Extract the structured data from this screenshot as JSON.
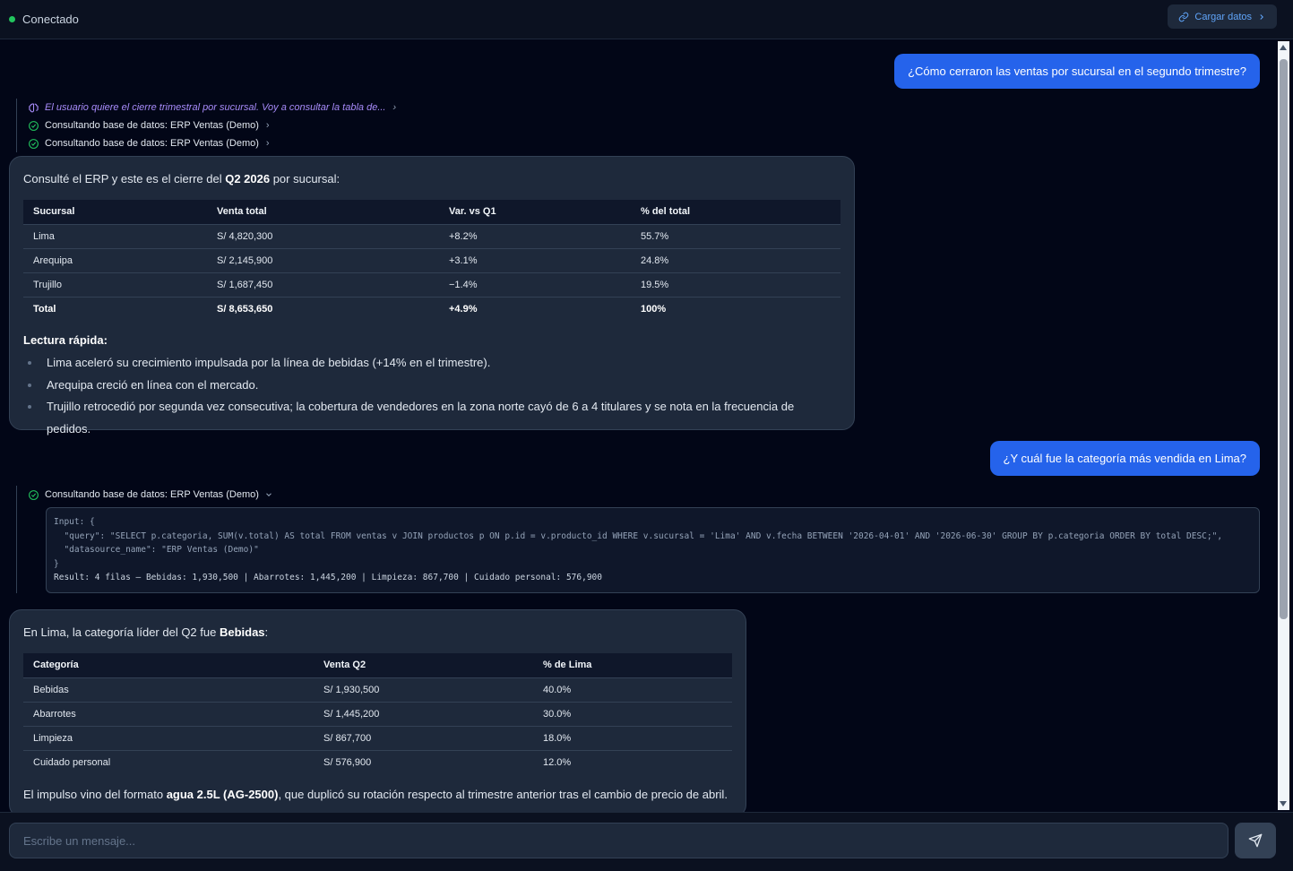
{
  "header": {
    "status": "Conectado",
    "load_button": "Cargar datos"
  },
  "messages": {
    "user1": "¿Cómo cerraron las ventas por sucursal en el segundo trimestre?",
    "steps1": {
      "thinking": "El usuario quiere el cierre trimestral por sucursal. Voy a consultar la tabla de...",
      "query_a": "Consultando base de datos: ERP Ventas (Demo)",
      "query_b": "Consultando base de datos: ERP Ventas (Demo)"
    },
    "assistant1": {
      "intro_pre": "Consulté el ERP y este es el cierre del ",
      "intro_bold": "Q2 2026",
      "intro_post": " por sucursal:",
      "table": {
        "headers": [
          "Sucursal",
          "Venta total",
          "Var. vs Q1",
          "% del total"
        ],
        "rows": [
          [
            "Lima",
            "S/ 4,820,300",
            "+8.2%",
            "55.7%"
          ],
          [
            "Arequipa",
            "S/ 2,145,900",
            "+3.1%",
            "24.8%"
          ],
          [
            "Trujillo",
            "S/ 1,687,450",
            "−1.4%",
            "19.5%"
          ]
        ],
        "total": [
          "Total",
          "S/ 8,653,650",
          "+4.9%",
          "100%"
        ]
      },
      "summary_title": "Lectura rápida:",
      "bullets": [
        "Lima aceleró su crecimiento impulsada por la línea de bebidas (+14% en el trimestre).",
        "Arequipa creció en línea con el mercado.",
        "Trujillo retrocedió por segunda vez consecutiva; la cobertura de vendedores en la zona norte cayó de 6 a 4 titulares y se nota en la frecuencia de pedidos."
      ]
    },
    "user2": "¿Y cuál fue la categoría más vendida en Lima?",
    "tool2": {
      "label": "Consultando base de datos: ERP Ventas (Demo)",
      "input_code": "Input: {\n  \"query\": \"SELECT p.categoria, SUM(v.total) AS total FROM ventas v JOIN productos p ON p.id = v.producto_id WHERE v.sucursal = 'Lima' AND v.fecha BETWEEN '2026-04-01' AND '2026-06-30' GROUP BY p.categoria ORDER BY total DESC;\",\n  \"datasource_name\": \"ERP Ventas (Demo)\"\n}",
      "result": "Result: 4 filas — Bebidas: 1,930,500 | Abarrotes: 1,445,200 | Limpieza: 867,700 | Cuidado personal: 576,900"
    },
    "assistant2": {
      "intro_pre": "En Lima, la categoría líder del Q2 fue ",
      "intro_bold": "Bebidas",
      "intro_post": ":",
      "table": {
        "headers": [
          "Categoría",
          "Venta Q2",
          "% de Lima"
        ],
        "rows": [
          [
            "Bebidas",
            "S/ 1,930,500",
            "40.0%"
          ],
          [
            "Abarrotes",
            "S/ 1,445,200",
            "30.0%"
          ],
          [
            "Limpieza",
            "S/ 867,700",
            "18.0%"
          ],
          [
            "Cuidado personal",
            "S/ 576,900",
            "12.0%"
          ]
        ]
      },
      "outro_pre": "El impulso vino del formato ",
      "outro_bold": "agua 2.5L (AG-2500)",
      "outro_post": ", que duplicó su rotación respecto al trimestre anterior tras el cambio de precio de abril."
    }
  },
  "composer": {
    "placeholder": "Escribe un mensaje..."
  },
  "colors": {
    "accent": "#2563eb",
    "status_ok": "#22c55e",
    "thinking": "#a78bfa",
    "link": "#60a5fa"
  }
}
